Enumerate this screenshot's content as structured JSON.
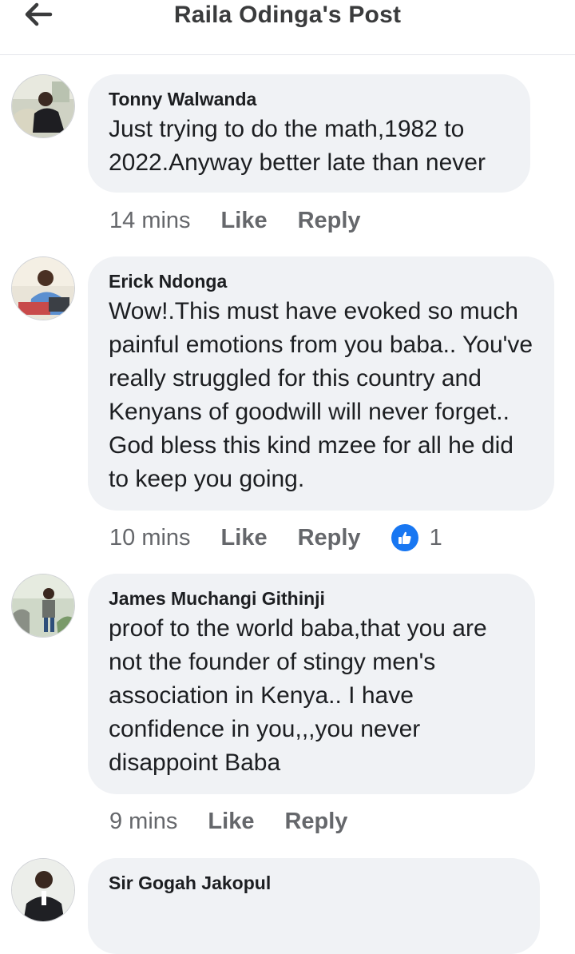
{
  "header": {
    "title": "Raila Odinga's Post",
    "back_icon": "arrow-left-icon"
  },
  "comments": [
    {
      "author": "Tonny Walwanda",
      "text": "Just trying to do the math,1982  to 2022.Anyway better late than never",
      "time": "14 mins",
      "like_label": "Like",
      "reply_label": "Reply"
    },
    {
      "author": "Erick Ndonga",
      "text": "Wow!.This must have evoked so much painful emotions from you baba.. You've really struggled for this country and Kenyans of goodwill will never forget.. God bless this kind mzee for all he did to keep you going.",
      "time": "10 mins",
      "like_label": "Like",
      "reply_label": "Reply",
      "reaction_icon": "thumbs-up-icon",
      "reaction_count": "1"
    },
    {
      "author": "James Muchangi Githinji",
      "text": "proof to the world baba,that you are not the founder of stingy men's association in Kenya.. I have confidence in you,,,you never disappoint Baba",
      "time": "9 mins",
      "like_label": "Like",
      "reply_label": "Reply"
    },
    {
      "author": "Sir Gogah Jakopul"
    }
  ],
  "colors": {
    "bubble": "#f0f2f5",
    "meta_text": "#65676b",
    "reaction_blue": "#1877f2"
  }
}
